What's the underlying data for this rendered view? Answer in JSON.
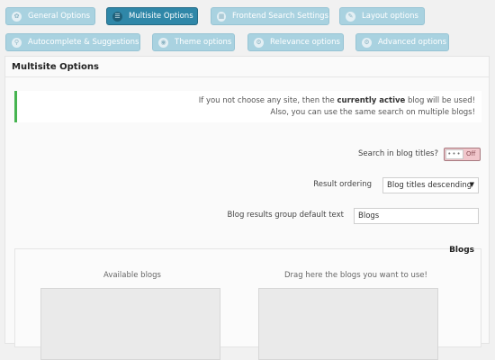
{
  "tabs": [
    {
      "label": "General Options",
      "icon": "gear-icon"
    },
    {
      "label": "Multisite Options",
      "icon": "list-icon",
      "active": true
    },
    {
      "label": "Frontend Search Settings",
      "icon": "settings-icon"
    },
    {
      "label": "Layout options",
      "icon": "pencil-icon"
    },
    {
      "label": "Autocomplete & Suggestions",
      "icon": "location-icon"
    },
    {
      "label": "Theme options",
      "icon": "eye-icon"
    },
    {
      "label": "Relevance options",
      "icon": "tune-icon"
    },
    {
      "label": "Advanced options",
      "icon": "tune-icon"
    }
  ],
  "panel": {
    "title": "Multisite Options"
  },
  "notice": {
    "line1_prefix": "If you not choose any site, then the ",
    "line1_bold": "currently active",
    "line1_suffix": " blog will be used!",
    "line2": "Also, you can use the same search on multiple blogs!"
  },
  "search_titles": {
    "label": "Search in blog titles?",
    "knob": "•••",
    "state": "Off"
  },
  "ordering": {
    "label": "Result ordering",
    "value": "Blog titles descending",
    "arrow": "▼"
  },
  "group_text": {
    "label": "Blog results group default text",
    "value": "Blogs"
  },
  "blogs": {
    "title": "Blogs",
    "available_label": "Available blogs",
    "drop_label": "Drag here the blogs you want to use!"
  },
  "colors": {
    "accent": "#2f87a8",
    "tab": "#a9d2e0",
    "notice_border": "#46b450",
    "toggle_off": "#f1c6cb"
  }
}
